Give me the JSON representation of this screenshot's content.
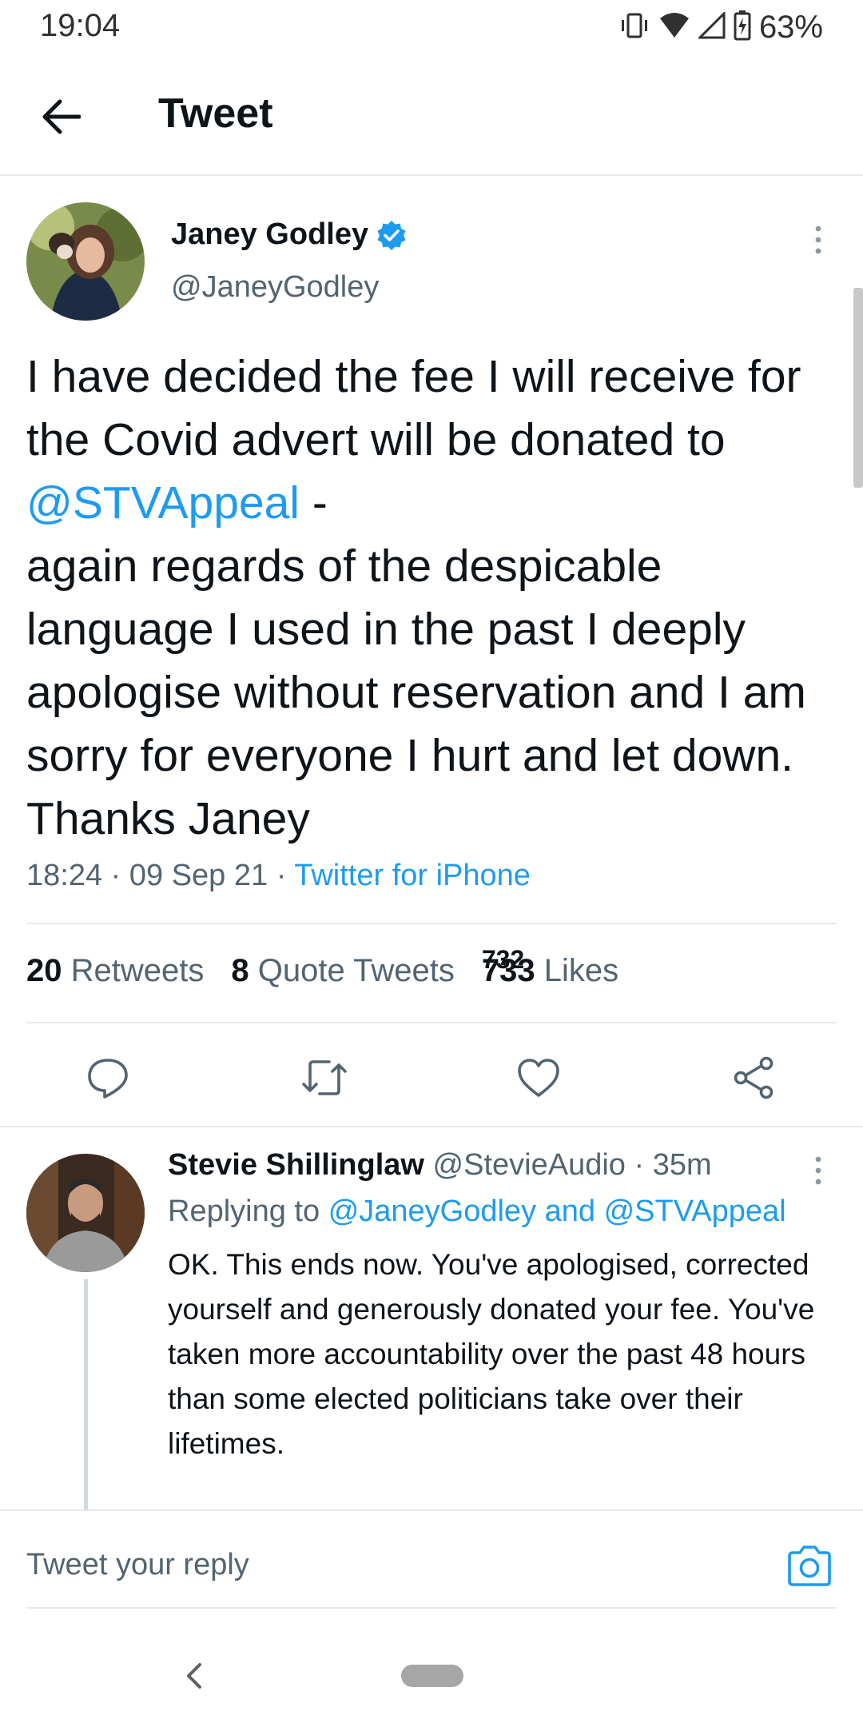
{
  "status_bar": {
    "time": "19:04",
    "battery": "63%",
    "icons": [
      "vibrate-icon",
      "wifi-icon",
      "signal-icon",
      "battery-charging-icon"
    ]
  },
  "header": {
    "title": "Tweet",
    "back_icon": "back-arrow-icon"
  },
  "tweet": {
    "author_name": "Janey Godley",
    "verified": true,
    "handle": "@JaneyGodley",
    "text_line1": "I have decided the fee I will receive for the Covid advert will be donated to ",
    "mention": "@STVAppeal",
    "text_line2": " -",
    "text_rest": "again regards of the despicable language I used in the past I deeply apologise without reservation and I am sorry for everyone I hurt and let down. Thanks Janey",
    "time": "18:24",
    "date": "09 Sep 21",
    "source": "Twitter for iPhone",
    "retweets_count": "20",
    "retweets_label": "Retweets",
    "quotes_count": "8",
    "quotes_label": "Quote Tweets",
    "likes_count_old": "732",
    "likes_count": "733",
    "likes_label": "Likes",
    "actions": [
      "reply-icon",
      "retweet-icon",
      "like-icon",
      "share-icon"
    ]
  },
  "reply": {
    "author_name": "Stevie Shillinglaw",
    "handle": "@StevieAudio",
    "age": "35m",
    "replying_label": "Replying to",
    "replying_targets": "@JaneyGodley and @STVAppeal",
    "text": "OK. This ends now. You've apologised, corrected yourself and generously donated your fee. You've taken more accountability over the past 48 hours than some elected politicians take over their lifetimes."
  },
  "composer": {
    "placeholder": "Tweet your reply",
    "camera_icon": "camera-icon"
  },
  "colors": {
    "link": "#1d9bf0",
    "secondary_text": "#536471",
    "primary_text": "#0f1419",
    "divider": "#e6e9ec"
  }
}
